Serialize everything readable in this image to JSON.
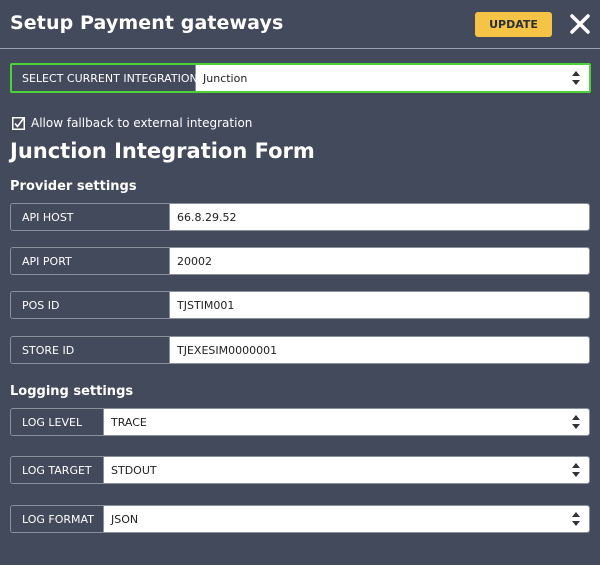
{
  "header": {
    "title": "Setup Payment gateways",
    "update_label": "UPDATE"
  },
  "integration": {
    "label": "SELECT CURRENT INTEGRATION",
    "value": "Junction"
  },
  "fallback": {
    "label": "Allow fallback to external integration",
    "checked": true
  },
  "form_title": "Junction Integration Form",
  "provider": {
    "title": "Provider settings",
    "fields": [
      {
        "label": "API HOST",
        "value": "66.8.29.52"
      },
      {
        "label": "API PORT",
        "value": "20002"
      },
      {
        "label": "POS ID",
        "value": "TJSTIM001"
      },
      {
        "label": "STORE ID",
        "value": "TJEXESIM0000001"
      }
    ]
  },
  "logging": {
    "title": "Logging settings",
    "fields": [
      {
        "label": "LOG LEVEL",
        "value": "TRACE"
      },
      {
        "label": "LOG TARGET",
        "value": "STDOUT"
      },
      {
        "label": "LOG FORMAT",
        "value": "JSON"
      }
    ]
  },
  "colors": {
    "background": "#434a5c",
    "accent_button": "#f5c447",
    "focus_border": "#4cd137"
  },
  "icons": {
    "close": "close-icon",
    "select_arrows": "sort-arrows-icon",
    "checkbox": "checkbox-checked-icon"
  }
}
